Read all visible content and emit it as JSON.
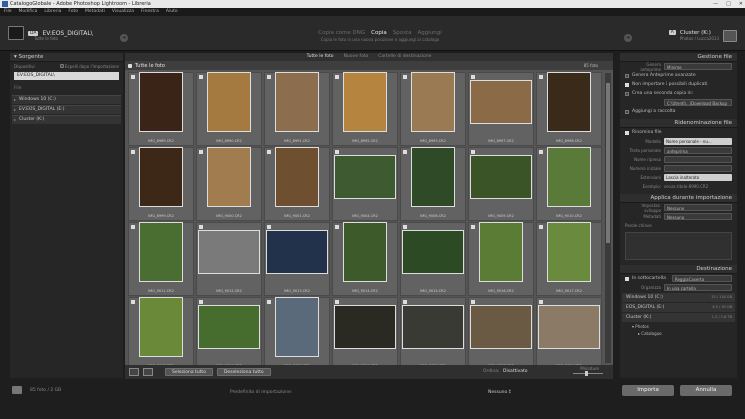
{
  "window": {
    "title": "CatalogoGlobale - Adobe Photoshop Lightroom - Libreria",
    "min": "—",
    "max": "□",
    "close": "✕"
  },
  "menu": [
    "File",
    "Modifica",
    "Libreria",
    "Foto",
    "Metadati",
    "Visualizza",
    "Finestra",
    "Aiuto"
  ],
  "header": {
    "from_tag": "DA",
    "source": "EV:EOS_DIGITAL\\",
    "source_sub": "Tutte le foto",
    "modes": [
      "Copia come DNG",
      "Copia",
      "Sposta",
      "Aggiungi"
    ],
    "mode_desc": "Copia le foto in una nuova posizione e aggiungi al catalogo",
    "to_tag": "A",
    "dest": "Cluster (K:)",
    "dest_sub": "Photos / Lucca2013"
  },
  "sources": {
    "title": "Sorgente",
    "device_label": "Dispositivi",
    "eject_label": "Espelli dopo l'importazione",
    "selected": "EV:EOS_DIGITAL\\",
    "files_label": "File",
    "volumes": [
      "Windows 10 (C:)",
      "EV:EOS_DIGITAL (E:)",
      "Cluster (K:)"
    ]
  },
  "grid": {
    "tabs": [
      "Tutte le foto",
      "Nuove foto",
      "Cartelle di destinazione"
    ],
    "header_label": "Tutte le foto",
    "count": "85 foto",
    "photos": [
      {
        "name": "IMG_8989.CR2",
        "o": "p",
        "c": "#3a2418"
      },
      {
        "name": "IMG_8990.CR2",
        "o": "p",
        "c": "#a47a40"
      },
      {
        "name": "IMG_8991.CR2",
        "o": "p",
        "c": "#8c6d4e"
      },
      {
        "name": "IMG_8992.CR2",
        "o": "p",
        "c": "#b5843f"
      },
      {
        "name": "IMG_8993.CR2",
        "o": "p",
        "c": "#9a7a52"
      },
      {
        "name": "IMG_8997.CR2",
        "o": "l",
        "c": "#8b6a48"
      },
      {
        "name": "IMG_8998.CR2",
        "o": "p",
        "c": "#3a2a1a"
      },
      {
        "name": "IMG_8999.CR2",
        "o": "p",
        "c": "#3d2818"
      },
      {
        "name": "IMG_9000.CR2",
        "o": "p",
        "c": "#a07c4e"
      },
      {
        "name": "IMG_9001.CR2",
        "o": "p",
        "c": "#6e5030"
      },
      {
        "name": "IMG_9004.CR2",
        "o": "l",
        "c": "#3e5a30"
      },
      {
        "name": "IMG_9006.CR2",
        "o": "p",
        "c": "#2f4a26"
      },
      {
        "name": "IMG_9009.CR2",
        "o": "l",
        "c": "#3a5428"
      },
      {
        "name": "IMG_9010.CR2",
        "o": "p",
        "c": "#5a7a3a"
      },
      {
        "name": "IMG_9011.CR2",
        "o": "p",
        "c": "#4a6e32"
      },
      {
        "name": "IMG_9012.CR2",
        "o": "l",
        "c": "#7a7a7a"
      },
      {
        "name": "IMG_9013.CR2",
        "o": "l",
        "c": "#22324a"
      },
      {
        "name": "IMG_9014.CR2",
        "o": "p",
        "c": "#3c5a2a"
      },
      {
        "name": "IMG_9015.CR2",
        "o": "l",
        "c": "#2c4a24"
      },
      {
        "name": "IMG_9016.CR2",
        "o": "p",
        "c": "#5a7c34"
      },
      {
        "name": "IMG_9017.CR2",
        "o": "p",
        "c": "#6a8a3e"
      },
      {
        "name": "IMG_9018.CR2",
        "o": "p",
        "c": "#6a8a3a"
      },
      {
        "name": "IMG_9019.CR2",
        "o": "l",
        "c": "#466c2e"
      },
      {
        "name": "IMG_9020.CR2",
        "o": "p",
        "c": "#5a6a7a"
      },
      {
        "name": "IMG_9021.CR2",
        "o": "l",
        "c": "#2a2a22"
      },
      {
        "name": "IMG_9022.CR2",
        "o": "l",
        "c": "#3a3a34"
      },
      {
        "name": "IMG_9023.CR2",
        "o": "l",
        "c": "#6a5a44"
      },
      {
        "name": "IMG_9024.CR2",
        "o": "l",
        "c": "#8a7a66"
      }
    ]
  },
  "toolbar": {
    "select_all": "Seleziona tutto",
    "deselect_all": "Deseleziona tutto",
    "sort_label": "Ordina:",
    "sort_value": "Disattivato",
    "thumbs_label": "Miniature"
  },
  "file_handling": {
    "title": "Gestione file",
    "preview_label": "Genera anteprime",
    "preview_value": "Minime",
    "smart_preview": "Genera Anteprime avanzate",
    "dont_import_dupes": "Non importare i possibili duplicati",
    "second_copy": "Crea una seconda copia in:",
    "second_copy_path": "C:\\Utenti\\...\\Download Backup",
    "add_collection": "Aggiungi a raccolta"
  },
  "rename": {
    "title": "Ridenominazione file",
    "rename_files": "Rinomina file",
    "model_label": "Modello",
    "model_value": "Nome personale - nu...",
    "custom_text_label": "Testo personale",
    "custom_text_value": "anteprima",
    "shoot_name_label": "Nome ripresa",
    "start_number_label": "Numero iniziale",
    "extensions_label": "Estensioni",
    "extensions_value": "Lascia inalterato",
    "example_label": "Esempio:",
    "example_value": "senza titolo-8990.CR2"
  },
  "apply": {
    "title": "Applica durante importazione",
    "dev_label": "Impostaz. sviluppo",
    "dev_value": "Nessuno",
    "meta_label": "Metadati",
    "meta_value": "Nessuno",
    "keywords_label": "Parole chiave"
  },
  "destination": {
    "title": "Destinazione",
    "subfolder_label": "In sottocartella",
    "subfolder_value": "ReggiaCaserta",
    "organize_label": "Organizza",
    "organize_value": "In una cartella",
    "volumes": [
      {
        "name": "Windows 10 (C:)",
        "meta": "33 / 118 GB"
      },
      {
        "name": "EOS_DIGITAL (E:)",
        "meta": "6.5 / 30 GB"
      },
      {
        "name": "Cluster (K:)",
        "meta": "1.2 / 1.8 TB"
      }
    ],
    "folders": [
      "Photos",
      "Cataloguo"
    ]
  },
  "bottom": {
    "count": "85 foto / 2 GB",
    "preset_label": "Predefinito di importazione:",
    "preset_value": "Nessuno ‡",
    "import": "Importa",
    "cancel": "Annulla"
  }
}
